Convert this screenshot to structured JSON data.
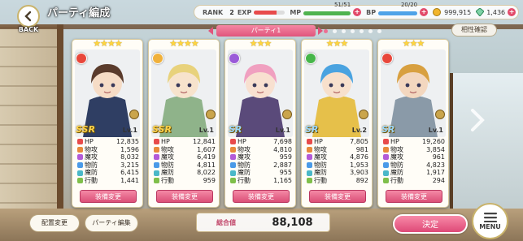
{
  "header": {
    "back_label": "BACK",
    "title": "パーティ編成"
  },
  "status": {
    "rank_label": "RANK",
    "rank": "2",
    "exp_label": "EXP",
    "mp_label": "MP",
    "mp": "51/51",
    "bp_label": "BP",
    "bp": "20/20",
    "gold": "999,915",
    "gems": "1,436",
    "exp_fraction": 0.72,
    "mp_fraction": 1.0,
    "bp_fraction": 1.0
  },
  "party": {
    "tab_label": "パーティ1",
    "page_count": 7,
    "active_page": 1,
    "compat_label": "相性確認"
  },
  "stat_labels": [
    "HP",
    "物攻",
    "魔攻",
    "物防",
    "魔防",
    "行動"
  ],
  "units": [
    {
      "stars": "★★★★",
      "rarity": "SSR",
      "level": "Lv.1",
      "element_color": "#e8473b",
      "stats": [
        "12,835",
        "1,596",
        "8,032",
        "3,215",
        "6,415",
        "1,441"
      ],
      "equip_label": "装備変更"
    },
    {
      "stars": "★★★★",
      "rarity": "SSR",
      "level": "Lv.1",
      "element_color": "#f0b13b",
      "stats": [
        "12,841",
        "1,607",
        "6,419",
        "4,811",
        "8,022",
        "959"
      ],
      "equip_label": "装備変更"
    },
    {
      "stars": "★★★",
      "rarity": "SR",
      "level": "Lv.1",
      "element_color": "#9a5ad8",
      "stats": [
        "7,698",
        "4,810",
        "959",
        "2,887",
        "955",
        "1,165"
      ],
      "equip_label": "装備変更"
    },
    {
      "stars": "★★★",
      "rarity": "SR",
      "level": "Lv.2",
      "element_color": "#46b64a",
      "stats": [
        "7,805",
        "981",
        "4,876",
        "1,953",
        "3,903",
        "892"
      ],
      "equip_label": "装備変更"
    },
    {
      "stars": "★★★",
      "rarity": "SR",
      "level": "Lv.1",
      "element_color": "#e8473b",
      "stats": [
        "19,260",
        "3,854",
        "961",
        "4,823",
        "1,917",
        "294"
      ],
      "equip_label": "装備変更"
    }
  ],
  "footer": {
    "placement_label": "配置変更",
    "party_edit_label": "パーティ編集",
    "total_label": "総合値",
    "total_value": "88,108",
    "confirm_label": "決定",
    "menu_label": "MENU"
  },
  "colors": {
    "accent_pink": "#e0557c",
    "ssr_gold": "#ffd24a",
    "sr_blue": "#9bd7ff"
  }
}
